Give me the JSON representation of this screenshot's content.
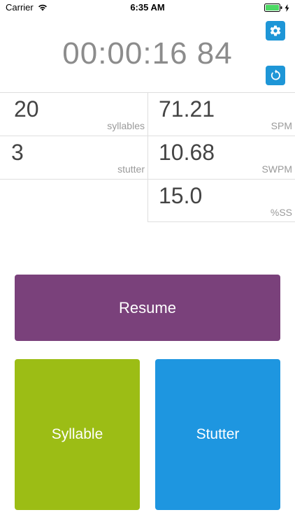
{
  "status_bar": {
    "carrier": "Carrier",
    "time": "6:35 AM",
    "icons": [
      "wifi-icon",
      "battery-icon",
      "charging-bolt-icon"
    ]
  },
  "timer": {
    "display": "00:00:16 84"
  },
  "toolbar": {
    "icons": [
      "gear-icon",
      "reset-icon"
    ],
    "accent_color": "#1e96d7"
  },
  "stats": {
    "syllables": {
      "value": "20",
      "label": "syllables"
    },
    "stutter": {
      "value": "3",
      "label": "stutter"
    },
    "spm": {
      "value": "71.21",
      "label": "SPM"
    },
    "swpm": {
      "value": "10.68",
      "label": "SWPM"
    },
    "ss": {
      "value": "15.0",
      "label": "%SS"
    }
  },
  "buttons": {
    "resume_label": "Resume",
    "syllable_label": "Syllable",
    "stutter_label": "Stutter",
    "resume_color": "#7a417b",
    "syllable_color": "#9cbd15",
    "stutter_color": "#1e96e0"
  }
}
